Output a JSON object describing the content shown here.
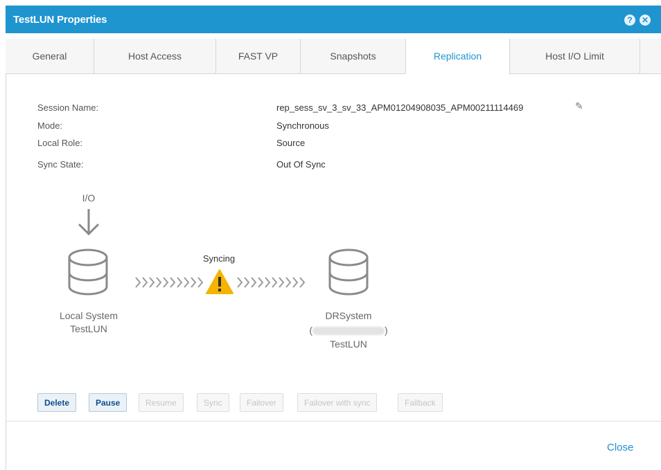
{
  "window": {
    "title": "TestLUN Properties"
  },
  "tabs": [
    {
      "label": "General"
    },
    {
      "label": "Host Access"
    },
    {
      "label": "FAST VP"
    },
    {
      "label": "Snapshots"
    },
    {
      "label": "Replication"
    },
    {
      "label": "Host I/O Limit"
    }
  ],
  "active_tab": "Replication",
  "session": {
    "name_label": "Session Name:",
    "name_value": "rep_sess_sv_3_sv_33_APM01204908035_APM00211114469",
    "mode_label": "Mode:",
    "mode_value": "Synchronous",
    "role_label": "Local Role:",
    "role_value": "Source",
    "sync_label": "Sync State:",
    "sync_value": "Out Of Sync"
  },
  "diagram": {
    "io_label": "I/O",
    "status": "Syncing",
    "local_line1": "Local System",
    "local_line2": "TestLUN",
    "remote_line1": "DRSystem",
    "remote_open": "(",
    "remote_close": ")",
    "remote_line3": "TestLUN",
    "colors": {
      "arrows": "#9a9a9a",
      "warning": "#f5b400",
      "db": "#8a8a8a"
    }
  },
  "actions": [
    {
      "label": "Delete",
      "enabled": true
    },
    {
      "label": "Pause",
      "enabled": true
    },
    {
      "label": "Resume",
      "enabled": false
    },
    {
      "label": "Sync",
      "enabled": false
    },
    {
      "label": "Failover",
      "enabled": false
    },
    {
      "label": "Failover with sync",
      "enabled": false
    },
    {
      "label": "Failback",
      "enabled": false
    }
  ],
  "footer": {
    "close_label": "Close"
  },
  "colors": {
    "titlebar": "#1f95d0",
    "accent": "#1f95d0"
  }
}
